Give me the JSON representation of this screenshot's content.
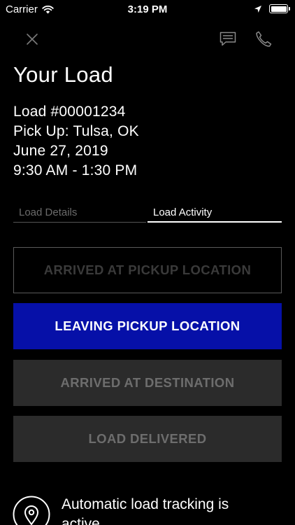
{
  "status_bar": {
    "carrier": "Carrier",
    "time": "3:19 PM",
    "battery_level": 1.0
  },
  "header": {
    "close_icon": "close-icon",
    "message_icon": "message-icon",
    "phone_icon": "phone-icon"
  },
  "page": {
    "title": "Your Load"
  },
  "load": {
    "number": "Load #00001234",
    "pickup": "Pick Up: Tulsa, OK",
    "date": "June 27, 2019",
    "time_window": "9:30 AM - 1:30 PM"
  },
  "tabs": [
    {
      "label": "Load Details",
      "active": false
    },
    {
      "label": "Load Activity",
      "active": true
    }
  ],
  "actions": {
    "arrived_pickup": "ARRIVED AT PICKUP LOCATION",
    "leaving_pickup": "LEAVING PICKUP LOCATION",
    "arrived_destination": "ARRIVED AT DESTINATION",
    "delivered": "LOAD DELIVERED"
  },
  "tracking": {
    "icon": "location-pin-icon",
    "text": "Automatic load tracking is active."
  },
  "colors": {
    "background": "#000000",
    "accent": "#0610a8",
    "disabled_bg": "#2b2b2b",
    "disabled_text": "#6d6d6d"
  }
}
